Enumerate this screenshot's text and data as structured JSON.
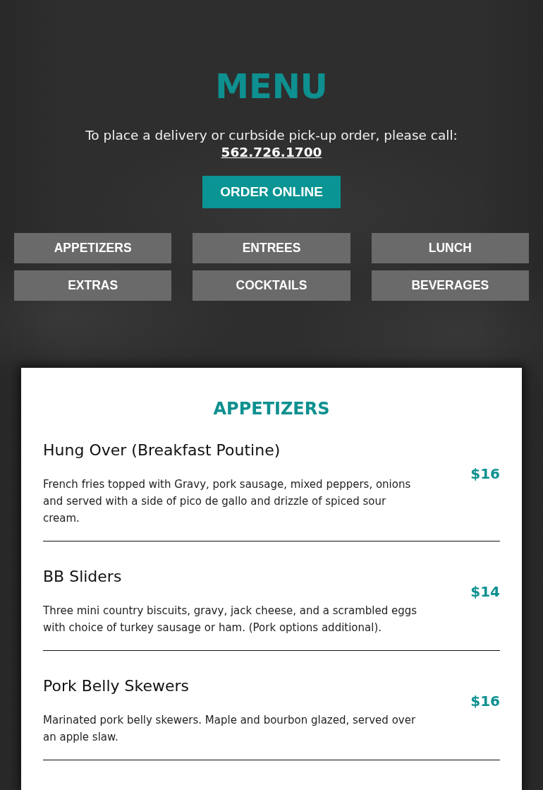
{
  "header": {
    "title": "MENU",
    "call_text": "To place a delivery or curbside pick-up order, please call:",
    "phone": "562.726.1700",
    "order_button": "ORDER ONLINE"
  },
  "categories": [
    "APPETIZERS",
    "ENTREES",
    "LUNCH",
    "EXTRAS",
    "COCKTAILS",
    "BEVERAGES"
  ],
  "section": {
    "title": "APPETIZERS",
    "items": [
      {
        "name": "Hung Over (Breakfast Poutine)",
        "description": "French fries topped with Gravy, pork sausage, mixed peppers, onions and served with a side of pico de gallo and drizzle of spiced sour cream.",
        "price": "$16"
      },
      {
        "name": "BB Sliders",
        "description": "Three mini country biscuits, gravy, jack cheese, and a scrambled eggs with choice of turkey sausage or ham. (Pork options additional).",
        "price": "$14"
      },
      {
        "name": "Pork Belly Skewers",
        "description": "Marinated pork belly skewers. Maple and bourbon glazed, served over an apple slaw.",
        "price": "$16"
      }
    ]
  }
}
